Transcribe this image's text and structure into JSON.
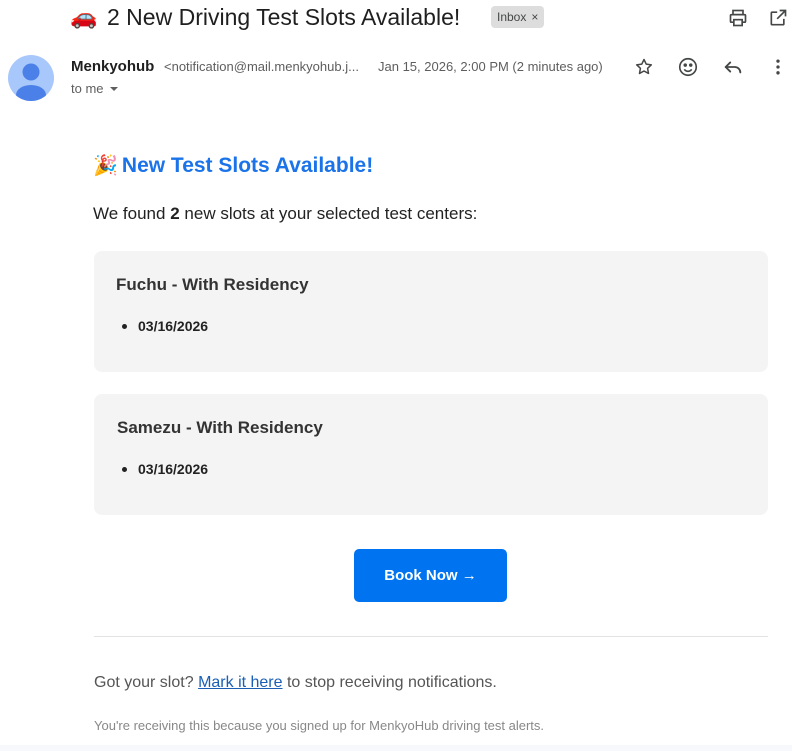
{
  "subject": {
    "emoji": "🚗",
    "text": "2 New Driving Test Slots Available!",
    "label_chip": "Inbox",
    "label_remove": "×"
  },
  "toolbar": {
    "print_icon": "print-icon",
    "open_new_window_icon": "open-in-new-icon"
  },
  "sender": {
    "name": "Menkyohub",
    "email": "<notification@mail.menkyohub.j...",
    "date": "Jan 15, 2026, 2:00 PM (2 minutes ago)",
    "to": "to me"
  },
  "actions": {
    "star_icon": "star-icon",
    "emoji_icon": "emoji-reaction-icon",
    "reply_icon": "reply-icon",
    "more_icon": "more-vert-icon"
  },
  "body": {
    "heading_emoji": "🎉",
    "heading": "New Test Slots Available!",
    "intro_prefix": "We found",
    "intro_count": "2",
    "intro_suffix": "new slots at your selected test centers:",
    "centers": [
      {
        "name": "Fuchu - With Residency",
        "dates": [
          "03/16/2026"
        ]
      },
      {
        "name": "Samezu - With Residency",
        "dates": [
          "03/16/2026"
        ]
      }
    ],
    "button_label": "Book Now →",
    "footer_prefix": "Got your slot?",
    "footer_link": "Mark it here",
    "footer_suffix": "to stop receiving notifications.",
    "disclaimer": "You're receiving this because you signed up for MenkyoHub driving test alerts."
  },
  "colors": {
    "heading": "#1a73e8",
    "button": "#0074f0",
    "card_bg": "#f4f4f4",
    "avatar_bg": "#a8c7fa",
    "avatar_fg": "#4a80e8"
  }
}
